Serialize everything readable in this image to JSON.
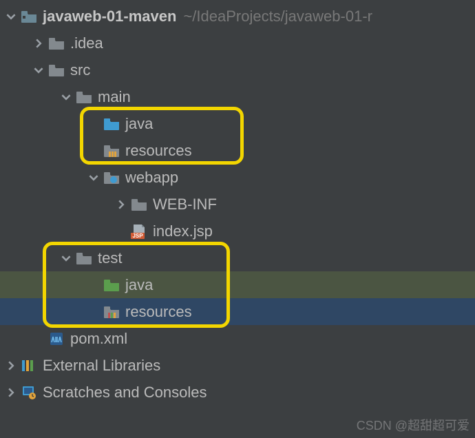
{
  "root": {
    "name": "javaweb-01-maven",
    "path": "~/IdeaProjects/javaweb-01-r"
  },
  "nodes": {
    "idea": ".idea",
    "src": "src",
    "main": "main",
    "main_java": "java",
    "main_resources": "resources",
    "webapp": "webapp",
    "web_inf": "WEB-INF",
    "index_jsp": "index.jsp",
    "test": "test",
    "test_java": "java",
    "test_resources": "resources",
    "pom": "pom.xml",
    "ext_lib": "External Libraries",
    "scratches": "Scratches and Consoles"
  },
  "jsp_badge": "JSP",
  "watermark": "CSDN @超甜超可爱"
}
